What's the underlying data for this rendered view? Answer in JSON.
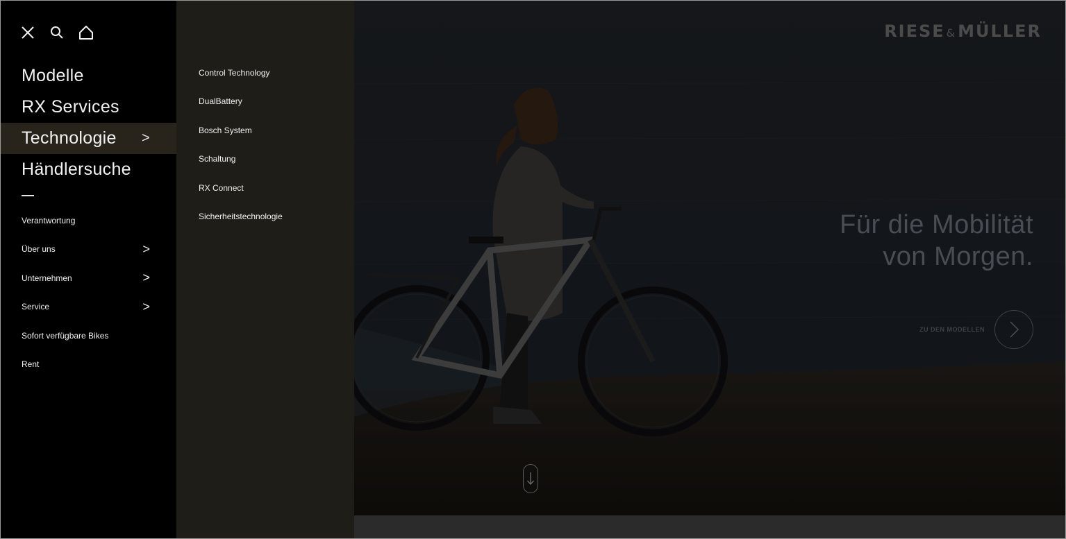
{
  "nav": {
    "tools": {
      "close_icon": "close-icon",
      "search_icon": "search-icon",
      "home_icon": "home-icon"
    },
    "main_links": [
      {
        "label": "Modelle",
        "active": false,
        "has_children": false
      },
      {
        "label": "RX Services",
        "active": false,
        "has_children": false
      },
      {
        "label": "Technologie",
        "active": true,
        "has_children": true
      },
      {
        "label": "Händlersuche",
        "active": false,
        "has_children": false
      }
    ],
    "main_chevron": ">",
    "sub_links": [
      {
        "label": "Verantwortung",
        "has_children": false
      },
      {
        "label": "Über uns",
        "has_children": true
      },
      {
        "label": "Unternehmen",
        "has_children": true
      },
      {
        "label": "Service",
        "has_children": true
      },
      {
        "label": "Sofort verfügbare Bikes",
        "has_children": false
      },
      {
        "label": "Rent",
        "has_children": false
      }
    ],
    "sub_chevron": ">"
  },
  "submenu": {
    "parent": "Technologie",
    "items": [
      "Control Technology",
      "DualBattery",
      "Bosch System",
      "Schaltung",
      "RX Connect",
      "Sicherheitstechnologie"
    ]
  },
  "hero": {
    "brand_left": "RIESE",
    "brand_amp": "&",
    "brand_right": "MÜLLER",
    "headline_line1": "Für die Mobilität",
    "headline_line2": "von Morgen.",
    "cta_label": "ZU DEN MODELLEN",
    "cta_icon": "chevron-right-icon",
    "scroll_icon": "arrow-down-icon"
  },
  "colors": {
    "nav_bg": "#000000",
    "nav_active_bg": "#28241c",
    "submenu_bg": "#1f1d17",
    "text_light": "#f2f2f2",
    "hero_text_dim": "#4a4e54"
  }
}
